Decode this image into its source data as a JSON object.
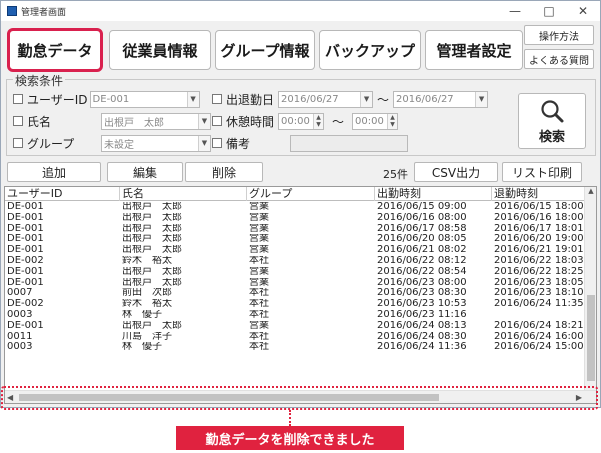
{
  "window": {
    "title": "管理者画面",
    "controls": {
      "minimize": "—",
      "maximize": "□",
      "close": "✕"
    }
  },
  "toolbar": {
    "tabs": [
      "勤怠データ",
      "従業員情報",
      "グループ情報",
      "バックアップ",
      "管理者設定"
    ],
    "active_tab": "勤怠データ",
    "side": {
      "help": "操作方法",
      "faq": "よくある質問"
    }
  },
  "search": {
    "legend": "検索条件",
    "user_id_label": "ユーザーID",
    "user_id_value": "DE-001",
    "name_label": "氏名",
    "name_value": "出根戸　太郎",
    "group_label": "グループ",
    "group_value": "未設定",
    "date_label": "出退勤日",
    "date_from": "2016/06/27",
    "date_sep": "～",
    "date_to": "2016/06/27",
    "break_label": "休憩時間",
    "break_from": "00:00",
    "break_sep": "～",
    "break_to": "00:00",
    "note_label": "備考",
    "search_button": "検索"
  },
  "actions": {
    "add": "追加",
    "edit": "編集",
    "delete": "削除",
    "count": "25件",
    "csv": "CSV出力",
    "print": "リスト印刷"
  },
  "table": {
    "headers": [
      "ユーザーID",
      "氏名",
      "グループ",
      "出勤時刻",
      "退勤時刻"
    ],
    "rows": [
      [
        "DE-001",
        "出根戸　太郎",
        "営業",
        "2016/06/15 09:00",
        "2016/06/15 18:00"
      ],
      [
        "DE-001",
        "出根戸　太郎",
        "営業",
        "2016/06/16 08:00",
        "2016/06/16 18:00"
      ],
      [
        "DE-001",
        "出根戸　太郎",
        "営業",
        "2016/06/17 08:58",
        "2016/06/17 18:01"
      ],
      [
        "DE-001",
        "出根戸　太郎",
        "営業",
        "2016/06/20 08:05",
        "2016/06/20 19:00"
      ],
      [
        "DE-001",
        "出根戸　太郎",
        "営業",
        "2016/06/21 08:02",
        "2016/06/21 19:01"
      ],
      [
        "DE-002",
        "鈴木　裕太",
        "本社",
        "2016/06/22 08:12",
        "2016/06/22 18:03"
      ],
      [
        "DE-001",
        "出根戸　太郎",
        "営業",
        "2016/06/22 08:54",
        "2016/06/22 18:25"
      ],
      [
        "DE-001",
        "出根戸　太郎",
        "営業",
        "2016/06/23 08:00",
        "2016/06/23 18:05"
      ],
      [
        "0007",
        "前田　次郎",
        "本社",
        "2016/06/23 08:30",
        "2016/06/23 18:10"
      ],
      [
        "DE-002",
        "鈴木　裕太",
        "本社",
        "2016/06/23 10:53",
        "2016/06/24 11:35"
      ],
      [
        "0003",
        "林　優子",
        "本社",
        "2016/06/23 11:16",
        ""
      ],
      [
        "DE-001",
        "出根戸　太郎",
        "営業",
        "2016/06/24 08:13",
        "2016/06/24 18:21"
      ],
      [
        "0011",
        "川島　洋子",
        "本社",
        "2016/06/24 08:30",
        "2016/06/24 16:00"
      ],
      [
        "0003",
        "林　優子",
        "本社",
        "2016/06/24 11:36",
        "2016/06/24 15:00"
      ]
    ]
  },
  "notice": "勤怠データを削除できました",
  "colors": {
    "accent": "#e0223f",
    "active_border": "#d9214e"
  }
}
